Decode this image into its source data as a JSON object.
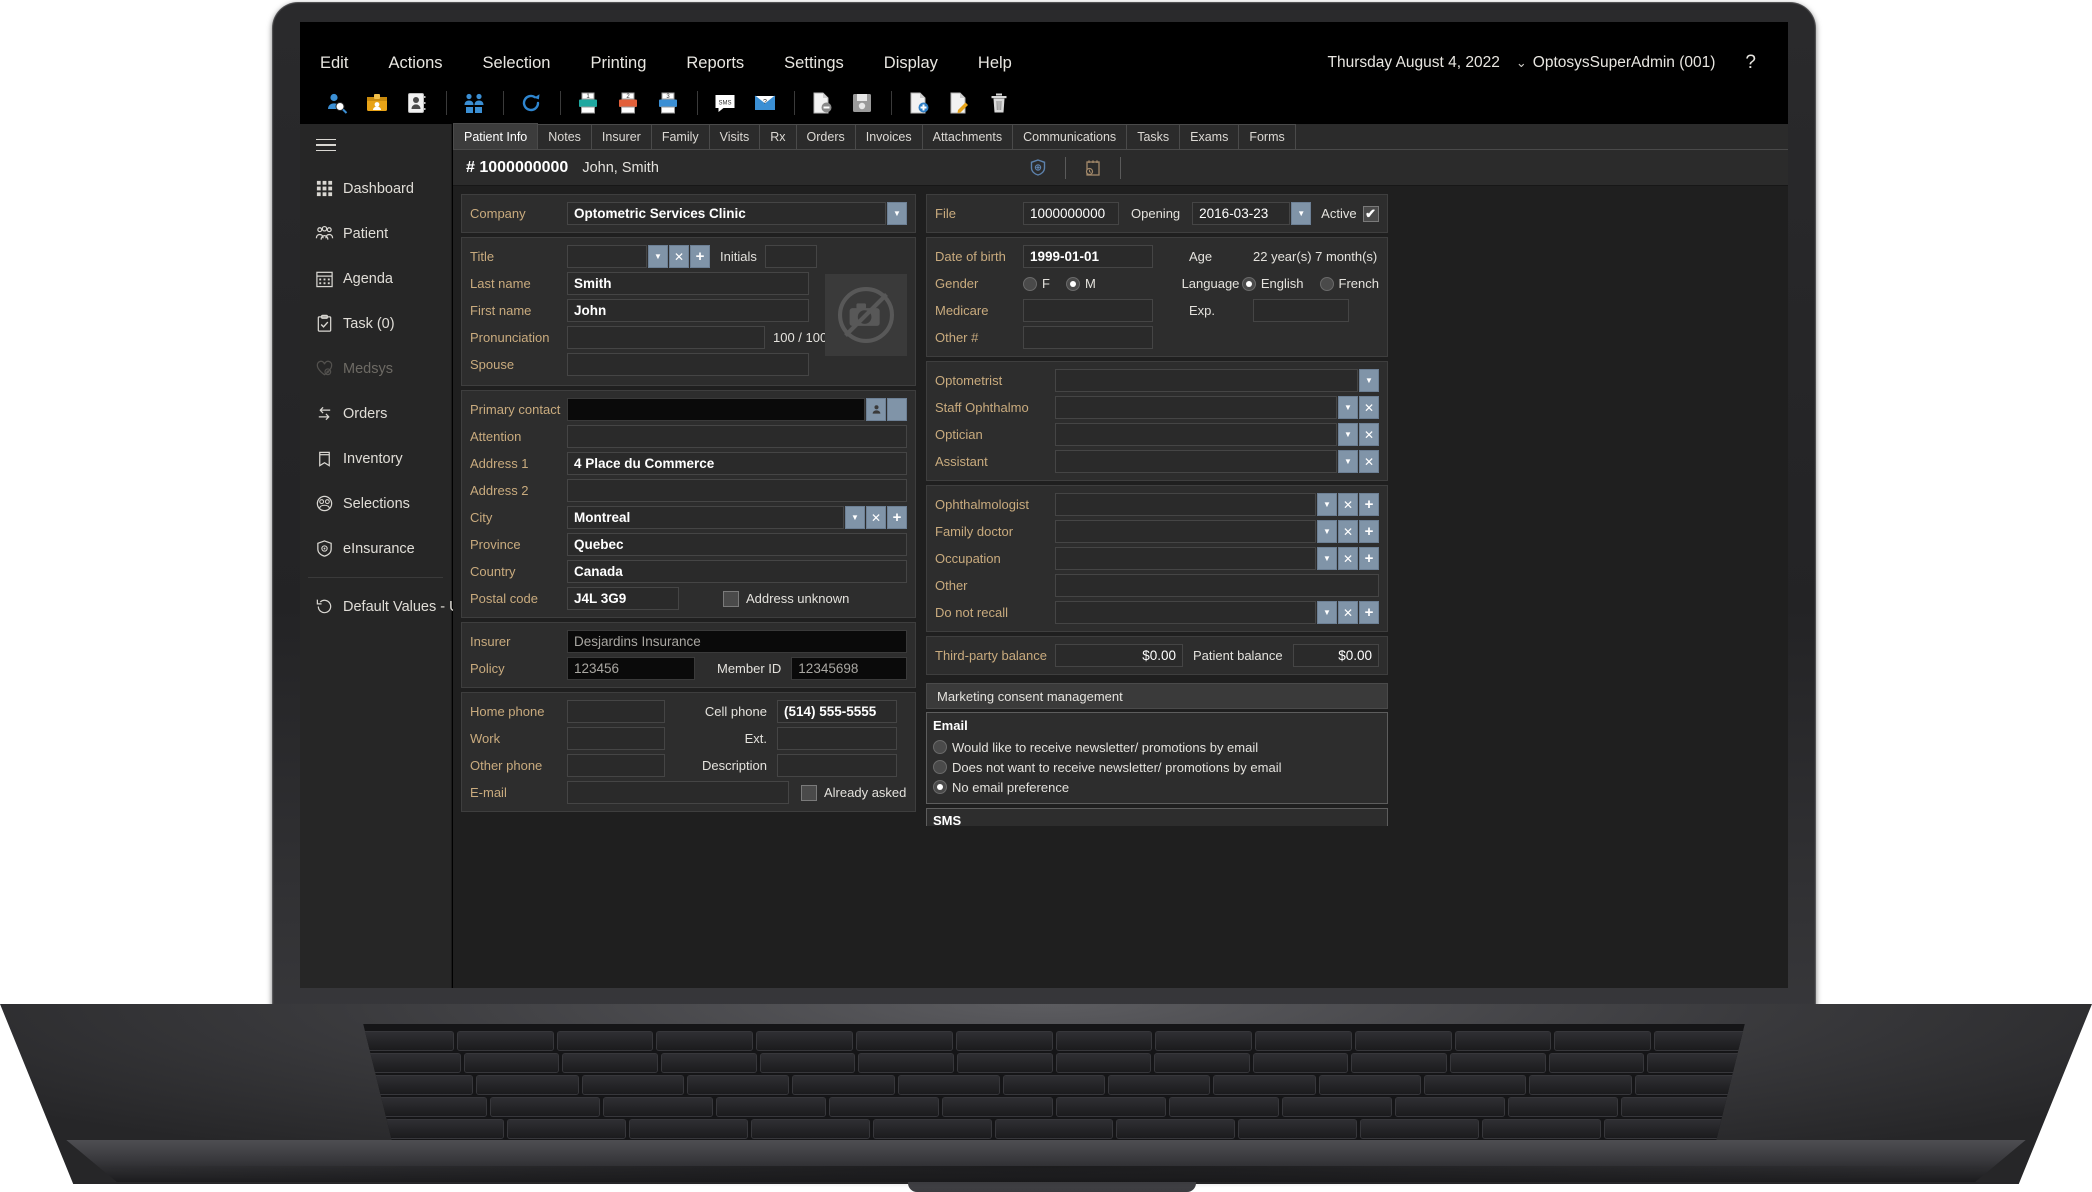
{
  "menubar": {
    "items": [
      "Edit",
      "Actions",
      "Selection",
      "Printing",
      "Reports",
      "Settings",
      "Display",
      "Help"
    ],
    "date": "Thursday August 4, 2022",
    "user": "OptosysSuperAdmin (001)",
    "chevron": "⌄",
    "help": "?"
  },
  "toolbar": {
    "icons": [
      {
        "name": "patient-search-icon"
      },
      {
        "name": "new-patient-folder-icon"
      },
      {
        "name": "patient-card-icon"
      },
      {
        "sep": true
      },
      {
        "name": "family-group-icon"
      },
      {
        "sep": true
      },
      {
        "name": "refresh-icon"
      },
      {
        "sep": true
      },
      {
        "name": "print-1-icon"
      },
      {
        "name": "print-2-icon"
      },
      {
        "name": "print-3-icon"
      },
      {
        "sep": true
      },
      {
        "name": "sms-icon"
      },
      {
        "name": "email-icon"
      },
      {
        "sep": true
      },
      {
        "name": "document-remove-icon"
      },
      {
        "name": "save-icon"
      },
      {
        "sep": true
      },
      {
        "name": "document-add-icon"
      },
      {
        "name": "document-edit-icon"
      },
      {
        "name": "delete-trash-icon"
      }
    ]
  },
  "sidebar": {
    "items": [
      {
        "label": "Dashboard",
        "icon": "grid-icon",
        "disabled": false
      },
      {
        "label": "Patient",
        "icon": "people-icon",
        "disabled": false
      },
      {
        "label": "Agenda",
        "icon": "calendar-icon",
        "disabled": false
      },
      {
        "label": "Task (0)",
        "icon": "clipboard-check-icon",
        "disabled": false
      },
      {
        "label": "Medsys",
        "icon": "heart-plus-icon",
        "disabled": true
      },
      {
        "label": "Orders",
        "icon": "exchange-arrows-icon",
        "disabled": false
      },
      {
        "label": "Inventory",
        "icon": "tag-icon",
        "disabled": false
      },
      {
        "label": "Selections",
        "icon": "group-circle-icon",
        "disabled": false
      },
      {
        "label": "eInsurance",
        "icon": "shield-icon",
        "disabled": false
      }
    ],
    "footer_item": {
      "label": "Default Values - Users",
      "icon": "history-revert-icon"
    }
  },
  "tabs": [
    {
      "label": "Patient Info",
      "active": true
    },
    {
      "label": "Notes",
      "active": false
    },
    {
      "label": "Insurer",
      "active": false
    },
    {
      "label": "Family",
      "active": false
    },
    {
      "label": "Visits",
      "active": false
    },
    {
      "label": "Rx",
      "active": false
    },
    {
      "label": "Orders",
      "active": false
    },
    {
      "label": "Invoices",
      "active": false
    },
    {
      "label": "Attachments",
      "active": false
    },
    {
      "label": "Communications",
      "active": false
    },
    {
      "label": "Tasks",
      "active": false
    },
    {
      "label": "Exams",
      "active": false
    },
    {
      "label": "Forms",
      "active": false
    }
  ],
  "patient_header": {
    "number": "# 1000000000",
    "name": "John, Smith",
    "icons": [
      "insurance-shield-icon",
      "appointment-calendar-icon"
    ]
  },
  "left_panel": {
    "company_label": "Company",
    "company_value": "Optometric Services Clinic",
    "identity": {
      "title_label": "Title",
      "title_value": "",
      "initials_label": "Initials",
      "initials_value": "",
      "last_name_label": "Last name",
      "last_name_value": "Smith",
      "first_name_label": "First name",
      "first_name_value": "John",
      "pronunciation_label": "Pronunciation",
      "pronunciation_value": "",
      "pronunciation_counter": "100 / 100",
      "spouse_label": "Spouse",
      "spouse_value": "",
      "photo_icon": "no-photo-camera-icon"
    },
    "address": {
      "primary_contact_label": "Primary contact",
      "primary_contact_value": "",
      "attention_label": "Attention",
      "attention_value": "",
      "address1_label": "Address 1",
      "address1_value": "4 Place du Commerce",
      "address2_label": "Address 2",
      "address2_value": "",
      "city_label": "City",
      "city_value": "Montreal",
      "province_label": "Province",
      "province_value": "Quebec",
      "country_label": "Country",
      "country_value": "Canada",
      "postal_label": "Postal code",
      "postal_value": "J4L 3G9",
      "address_unknown_label": "Address unknown",
      "address_unknown_checked": false
    },
    "insurance": {
      "insurer_label": "Insurer",
      "insurer_value": "Desjardins Insurance",
      "policy_label": "Policy",
      "policy_value": "123456",
      "member_id_label": "Member ID",
      "member_id_value": "12345698"
    },
    "contact": {
      "home_phone_label": "Home phone",
      "home_phone_value": "",
      "cell_phone_label": "Cell phone",
      "cell_phone_value": "(514) 555-5555",
      "work_label": "Work",
      "work_value": "",
      "ext_label": "Ext.",
      "ext_value": "",
      "other_phone_label": "Other phone",
      "other_phone_value": "",
      "description_label": "Description",
      "description_value": "",
      "email_label": "E-mail",
      "email_value": "",
      "already_asked_label": "Already asked",
      "already_asked_checked": false
    }
  },
  "right_panel": {
    "file": {
      "file_label": "File",
      "file_value": "1000000000",
      "opening_label": "Opening",
      "opening_value": "2016-03-23",
      "active_label": "Active",
      "active_checked": true
    },
    "demographics": {
      "dob_label": "Date of birth",
      "dob_value": "1999-01-01",
      "age_label": "Age",
      "age_value": "22 year(s) 7 month(s)",
      "gender_label": "Gender",
      "gender_f_label": "F",
      "gender_m_label": "M",
      "gender_selected": "M",
      "language_label": "Language",
      "language_en_label": "English",
      "language_fr_label": "French",
      "language_selected": "English",
      "medicare_label": "Medicare",
      "medicare_value": "",
      "exp_label": "Exp.",
      "exp_value": "",
      "other_num_label": "Other #",
      "other_num_value": ""
    },
    "providers": [
      {
        "label": "Optometrist",
        "value": "",
        "buttons": [
          "caret"
        ]
      },
      {
        "label": "Staff Ophthalmo",
        "value": "",
        "buttons": [
          "caret",
          "x"
        ]
      },
      {
        "label": "Optician",
        "value": "",
        "buttons": [
          "caret",
          "x"
        ]
      },
      {
        "label": "Assistant",
        "value": "",
        "buttons": [
          "caret",
          "x"
        ]
      }
    ],
    "externals": [
      {
        "label": "Ophthalmologist",
        "value": "",
        "buttons": [
          "caret",
          "x",
          "plus"
        ]
      },
      {
        "label": "Family doctor",
        "value": "",
        "buttons": [
          "caret",
          "x",
          "plus"
        ]
      },
      {
        "label": "Occupation",
        "value": "",
        "buttons": [
          "caret",
          "x",
          "plus"
        ]
      },
      {
        "label": "Other",
        "value": "",
        "buttons": []
      },
      {
        "label": "Do not recall",
        "value": "",
        "buttons": [
          "caret",
          "x",
          "plus"
        ]
      }
    ],
    "balances": {
      "third_party_label": "Third-party balance",
      "third_party_value": "$0.00",
      "patient_label": "Patient balance",
      "patient_value": "$0.00"
    },
    "consent": {
      "title": "Marketing consent management",
      "email_heading": "Email",
      "email_options": [
        {
          "label": "Would like to receive newsletter/ promotions by email",
          "selected": false
        },
        {
          "label": "Does not want to receive newsletter/ promotions by email",
          "selected": false
        },
        {
          "label": "No email preference",
          "selected": true
        }
      ],
      "sms_heading": "SMS"
    }
  },
  "colors": {
    "accent_blue": "#3b8fd4",
    "label_tan": "#c9ab7e",
    "panel_bg": "#2d2d2d",
    "content_bg": "#1f1f1f",
    "sidebar_bg": "#262626",
    "button_blue": "#8094a8"
  }
}
